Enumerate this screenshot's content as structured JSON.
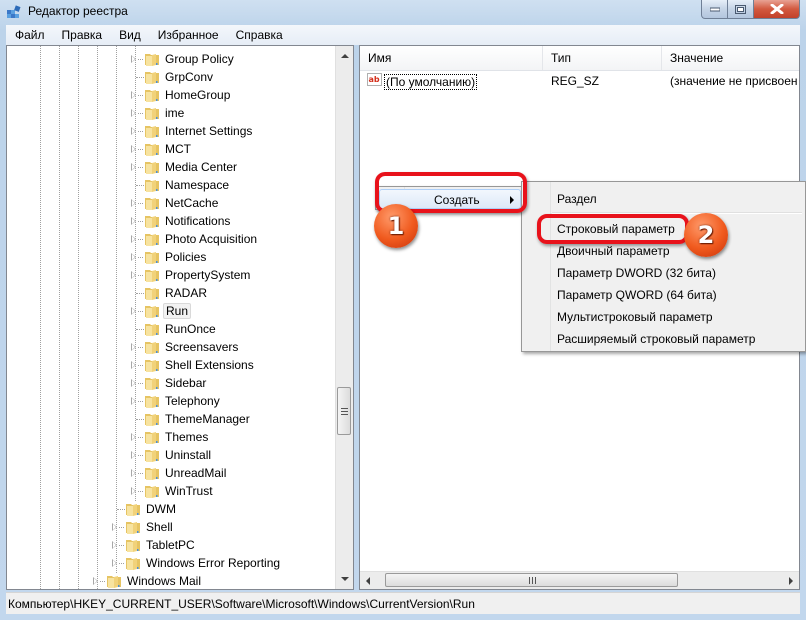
{
  "window": {
    "title": "Редактор реестра",
    "app_icon": "registry-editor-icon",
    "controls": [
      "minimize-icon",
      "maximize-icon",
      "close-icon"
    ]
  },
  "menubar": [
    "Файл",
    "Правка",
    "Вид",
    "Избранное",
    "Справка"
  ],
  "tree": {
    "selected": "Run",
    "nodes": [
      {
        "label": "Group Policy",
        "expandable": true,
        "level": 7
      },
      {
        "label": "GrpConv",
        "expandable": false,
        "level": 7
      },
      {
        "label": "HomeGroup",
        "expandable": true,
        "level": 7
      },
      {
        "label": "ime",
        "expandable": true,
        "level": 7
      },
      {
        "label": "Internet Settings",
        "expandable": true,
        "level": 7
      },
      {
        "label": "MCT",
        "expandable": true,
        "level": 7
      },
      {
        "label": "Media Center",
        "expandable": true,
        "level": 7
      },
      {
        "label": "Namespace",
        "expandable": false,
        "level": 7
      },
      {
        "label": "NetCache",
        "expandable": true,
        "level": 7
      },
      {
        "label": "Notifications",
        "expandable": true,
        "level": 7
      },
      {
        "label": "Photo Acquisition",
        "expandable": true,
        "level": 7
      },
      {
        "label": "Policies",
        "expandable": true,
        "level": 7
      },
      {
        "label": "PropertySystem",
        "expandable": true,
        "level": 7
      },
      {
        "label": "RADAR",
        "expandable": false,
        "level": 7
      },
      {
        "label": "Run",
        "expandable": true,
        "level": 7
      },
      {
        "label": "RunOnce",
        "expandable": false,
        "level": 7
      },
      {
        "label": "Screensavers",
        "expandable": true,
        "level": 7
      },
      {
        "label": "Shell Extensions",
        "expandable": true,
        "level": 7
      },
      {
        "label": "Sidebar",
        "expandable": true,
        "level": 7
      },
      {
        "label": "Telephony",
        "expandable": true,
        "level": 7
      },
      {
        "label": "ThemeManager",
        "expandable": false,
        "level": 7
      },
      {
        "label": "Themes",
        "expandable": true,
        "level": 7
      },
      {
        "label": "Uninstall",
        "expandable": true,
        "level": 7
      },
      {
        "label": "UnreadMail",
        "expandable": true,
        "level": 7
      },
      {
        "label": "WinTrust",
        "expandable": true,
        "level": 7
      },
      {
        "label": "DWM",
        "expandable": false,
        "level": 6
      },
      {
        "label": "Shell",
        "expandable": true,
        "level": 6
      },
      {
        "label": "TabletPC",
        "expandable": true,
        "level": 6
      },
      {
        "label": "Windows Error Reporting",
        "expandable": true,
        "level": 6
      },
      {
        "label": "Windows Mail",
        "expandable": true,
        "level": 5
      }
    ]
  },
  "list": {
    "columns": [
      "Имя",
      "Тип",
      "Значение"
    ],
    "rows": [
      {
        "icon": "string-value-icon",
        "name": "(По умолчанию)",
        "type": "REG_SZ",
        "value": "(значение не присвоен"
      }
    ]
  },
  "context_menu": {
    "item": "Создать",
    "submenu": [
      "Раздел",
      "Строковый параметр",
      "Двоичный параметр",
      "Параметр DWORD (32 бита)",
      "Параметр QWORD (64 бита)",
      "Мультистроковый параметр",
      "Расширяемый строковый параметр"
    ]
  },
  "annotations": {
    "step1": "1",
    "step2": "2",
    "highlight_color": "#e8121b",
    "badge_color": "#f05a1e"
  },
  "statusbar": {
    "path": "Компьютер\\HKEY_CURRENT_USER\\Software\\Microsoft\\Windows\\CurrentVersion\\Run"
  }
}
